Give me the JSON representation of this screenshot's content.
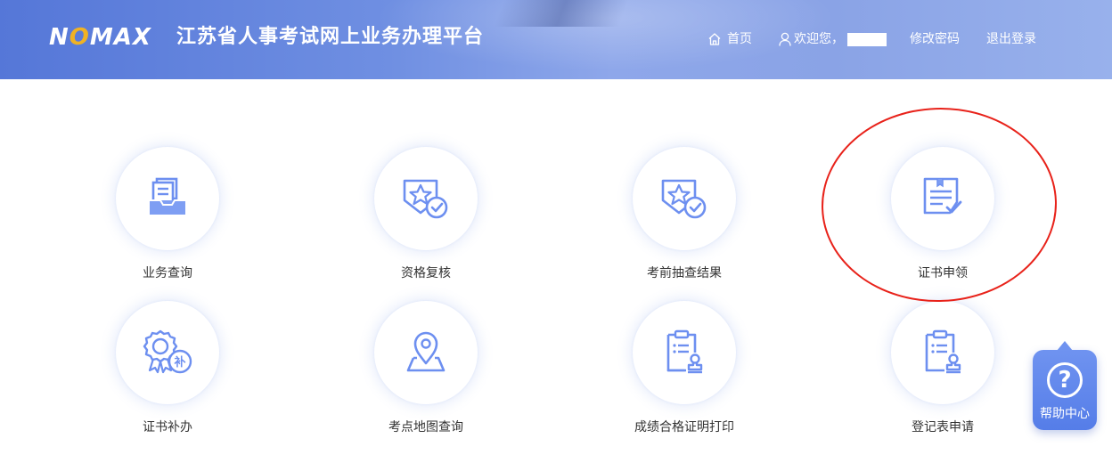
{
  "header": {
    "logo_text_1": "N",
    "logo_text_2": "O",
    "logo_text_3": "MAX",
    "site_title": "江苏省人事考试网上业务办理平台",
    "nav": {
      "home": "首页",
      "welcome": "欢迎您，",
      "change_password": "修改密码",
      "logout": "退出登录"
    }
  },
  "tiles": [
    {
      "label": "业务查询",
      "icon": "tray-icon"
    },
    {
      "label": "资格复核",
      "icon": "badge-check-icon"
    },
    {
      "label": "考前抽查结果",
      "icon": "badge-check-icon"
    },
    {
      "label": "证书申领",
      "icon": "certificate-document-icon"
    },
    {
      "label": "证书补办",
      "icon": "seal-badge-icon",
      "badge_text": "补"
    },
    {
      "label": "考点地图查询",
      "icon": "map-pin-icon"
    },
    {
      "label": "成绩合格证明打印",
      "icon": "clipboard-stamp-icon"
    },
    {
      "label": "登记表申请",
      "icon": "clipboard-stamp-icon"
    }
  ],
  "help": {
    "label": "帮助中心",
    "symbol": "?"
  },
  "colors": {
    "accent": "#5b7fe4",
    "icon_blue": "#6d8ff0",
    "annotation_red": "#e8221a"
  }
}
